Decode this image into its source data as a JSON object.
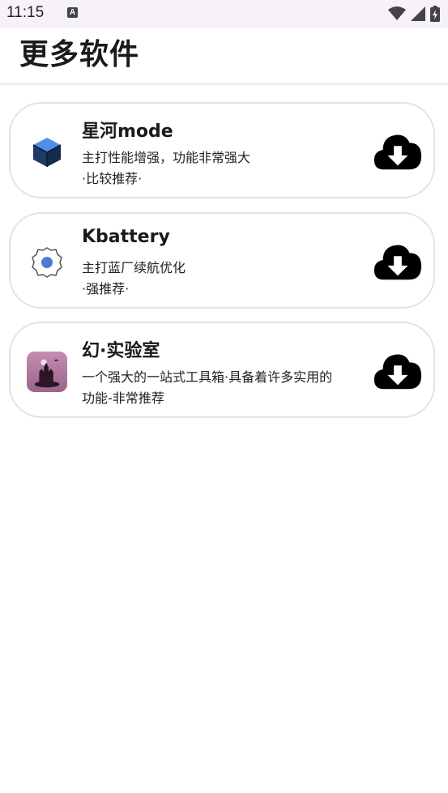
{
  "status_bar": {
    "time": "11:15",
    "notification_letter": "A"
  },
  "header": {
    "title": "更多软件"
  },
  "apps": [
    {
      "name": "星河mode",
      "desc_line1": "主打性能增强，功能非常强大",
      "desc_line2": "·比较推荐·",
      "icon": "blue-cube-icon"
    },
    {
      "name": "Kbattery",
      "desc_line1": "主打蓝厂续航优化",
      "desc_line2": "·强推荐·",
      "icon": "gear-icon"
    },
    {
      "name": "幻·实验室",
      "desc_line1": "一个强大的一站式工具箱·具备着许多实用的",
      "desc_line2": "功能-非常推荐",
      "icon": "castle-app-icon"
    }
  ],
  "colors": {
    "status_bar_bg": "#f7f2fa",
    "card_border": "#e3e3e3",
    "cube_blue": "#3a7bd5",
    "gear_blue": "#4a7fd0",
    "castle_bg": "#b07aa1"
  }
}
